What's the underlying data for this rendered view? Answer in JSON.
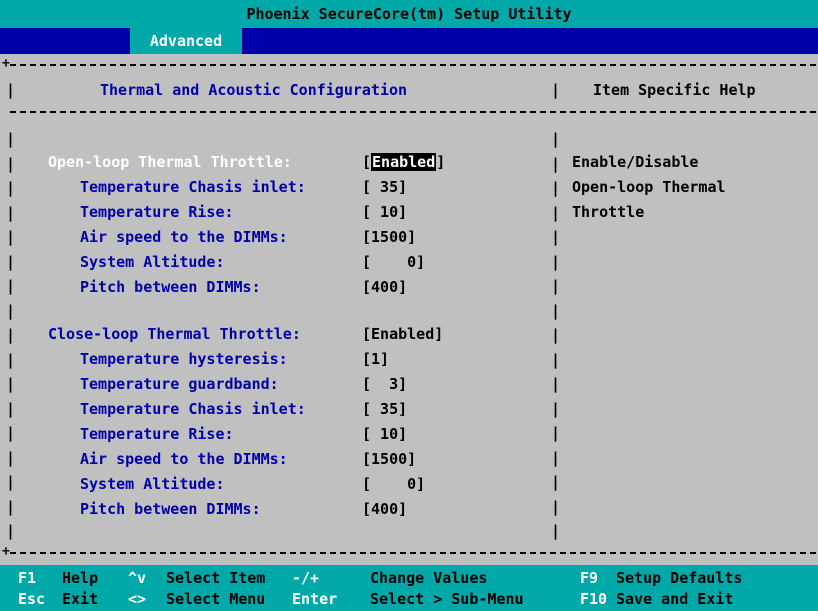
{
  "title": "Phoenix SecureCore(tm) Setup Utility",
  "menu": {
    "active_tab": "Advanced"
  },
  "panel": {
    "title": "Thermal and Acoustic Configuration",
    "help_title": "Item Specific Help",
    "help_lines": [
      "Enable/Disable",
      "Open-loop Thermal",
      "Throttle"
    ]
  },
  "open_loop": {
    "label": "Open-loop Thermal Throttle:",
    "value_open": "[",
    "value_text": "Enabled",
    "value_close": "]",
    "items": [
      {
        "label": "Temperature Chasis inlet:",
        "value": "[ 35]"
      },
      {
        "label": "Temperature Rise:",
        "value": "[ 10]"
      },
      {
        "label": "Air speed to the DIMMs:",
        "value": "[1500]"
      },
      {
        "label": "System Altitude:",
        "value": "[    0]"
      },
      {
        "label": "Pitch between DIMMs:",
        "value": "[400]"
      }
    ]
  },
  "close_loop": {
    "label": "Close-loop Thermal Throttle:",
    "value": "[Enabled]",
    "items": [
      {
        "label": "Temperature hysteresis:",
        "value": "[1]"
      },
      {
        "label": "Temperature guardband:",
        "value": "[  3]"
      },
      {
        "label": "Temperature Chasis inlet:",
        "value": "[ 35]"
      },
      {
        "label": "Temperature Rise:",
        "value": "[ 10]"
      },
      {
        "label": "Air speed to the DIMMs:",
        "value": "[1500]"
      },
      {
        "label": "System Altitude:",
        "value": "[    0]"
      },
      {
        "label": "Pitch between DIMMs:",
        "value": "[400]"
      }
    ]
  },
  "footer": {
    "row1": [
      {
        "key": "F1",
        "action": "Help"
      },
      {
        "key": "^v",
        "action": "Select Item"
      },
      {
        "key": "-/+",
        "action": "Change Values"
      },
      {
        "key": "F9",
        "action": "Setup Defaults"
      }
    ],
    "row2": [
      {
        "key": "Esc",
        "action": "Exit"
      },
      {
        "key": "<>",
        "action": "Select Menu"
      },
      {
        "key": "Enter",
        "action": "Select > Sub-Menu"
      },
      {
        "key": "F10",
        "action": "Save and Exit"
      }
    ]
  },
  "colors": {
    "background": "#c0c0c0",
    "title_bar": "#00a8a8",
    "menu_bar": "#0000a8",
    "label": "#0000a8",
    "key": "#ffffff"
  }
}
